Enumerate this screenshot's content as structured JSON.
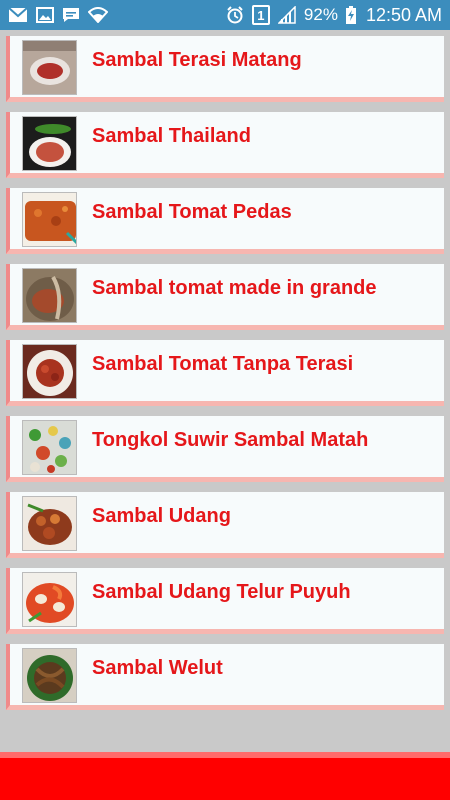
{
  "status_bar": {
    "left_icons": [
      "gmail-icon",
      "gallery-icon",
      "chat-icon",
      "wifi-icon"
    ],
    "right_icons": [
      "alarm-icon",
      "sim-1-icon",
      "signal-icon",
      "battery-charging-icon"
    ],
    "sim_label": "1",
    "battery": "92%",
    "time": "12:50 AM"
  },
  "recipes": [
    {
      "title": "Sambal Terasi Matang",
      "thumb": "sambal-terasi-matang-thumbnail"
    },
    {
      "title": "Sambal Thailand",
      "thumb": "sambal-thailand-thumbnail"
    },
    {
      "title": "Sambal Tomat Pedas",
      "thumb": "sambal-tomat-pedas-thumbnail"
    },
    {
      "title": "Sambal tomat made in grande",
      "thumb": "sambal-tomat-made-in-grande-thumbnail"
    },
    {
      "title": "Sambal Tomat Tanpa Terasi",
      "thumb": "sambal-tomat-tanpa-terasi-thumbnail"
    },
    {
      "title": "Tongkol Suwir Sambal Matah",
      "thumb": "tongkol-suwir-sambal-matah-thumbnail"
    },
    {
      "title": "Sambal Udang",
      "thumb": "sambal-udang-thumbnail"
    },
    {
      "title": "Sambal Udang Telur Puyuh",
      "thumb": "sambal-udang-telur-puyuh-thumbnail"
    },
    {
      "title": "Sambal Welut",
      "thumb": "sambal-welut-thumbnail"
    }
  ],
  "colors": {
    "status_bar": "#3c8dbd",
    "title_text": "#e5171a",
    "row_accent": "#f08a8a",
    "footer": "#ff0000"
  }
}
